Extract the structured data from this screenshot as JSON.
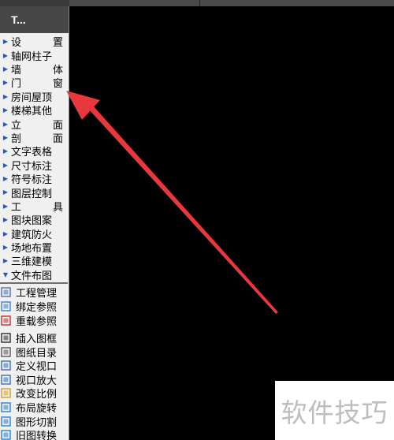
{
  "panel": {
    "title": "T...",
    "menu": [
      {
        "label": "设　置",
        "spread": true
      },
      {
        "label": "轴网柱子",
        "spread": false
      },
      {
        "label": "墙　体",
        "spread": true
      },
      {
        "label": "门　窗",
        "spread": true
      },
      {
        "label": "房间屋顶",
        "spread": false
      },
      {
        "label": "楼梯其他",
        "spread": false
      },
      {
        "label": "立　面",
        "spread": true
      },
      {
        "label": "剖　面",
        "spread": true
      },
      {
        "label": "文字表格",
        "spread": false
      },
      {
        "label": "尺寸标注",
        "spread": false
      },
      {
        "label": "符号标注",
        "spread": false
      },
      {
        "label": "图层控制",
        "spread": false
      },
      {
        "label": "工　具",
        "spread": true
      },
      {
        "label": "图块图案",
        "spread": false
      },
      {
        "label": "建筑防火",
        "spread": false
      },
      {
        "label": "场地布置",
        "spread": false
      },
      {
        "label": "三维建模",
        "spread": false
      },
      {
        "label": "文件布图",
        "spread": false
      }
    ],
    "tools_group1": [
      {
        "label": "工程管理",
        "icon": "project-manage-icon"
      },
      {
        "label": "绑定参照",
        "icon": "bind-xref-icon"
      },
      {
        "label": "重载参照",
        "icon": "reload-xref-icon"
      }
    ],
    "tools_group2": [
      {
        "label": "插入图框",
        "icon": "insert-frame-icon"
      },
      {
        "label": "图纸目录",
        "icon": "drawing-catalog-icon"
      },
      {
        "label": "定义视口",
        "icon": "define-viewport-icon"
      },
      {
        "label": "视口放大",
        "icon": "viewport-zoom-icon"
      },
      {
        "label": "改变比例",
        "icon": "change-scale-icon"
      },
      {
        "label": "布局旋转",
        "icon": "layout-rotate-icon"
      },
      {
        "label": "图形切割",
        "icon": "graphic-cut-icon"
      },
      {
        "label": "旧图转换",
        "icon": "old-drawing-convert-icon"
      }
    ]
  },
  "watermark": {
    "text": "软件技巧"
  },
  "colors": {
    "annotation_arrow": "#e8383d",
    "panel_header": "#474747",
    "canvas": "#000000"
  }
}
